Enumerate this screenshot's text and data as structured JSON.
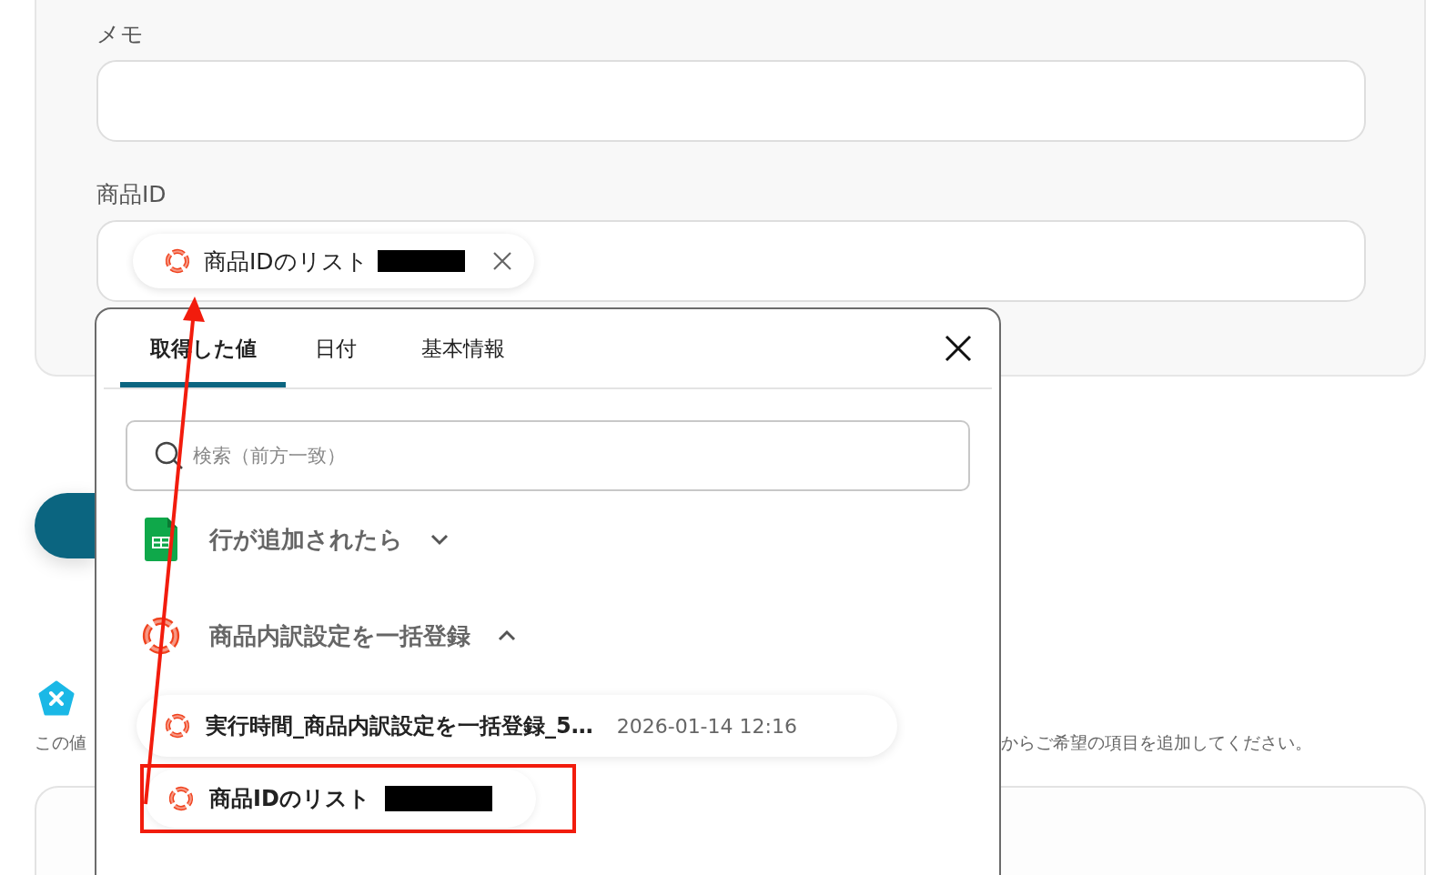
{
  "memo_field": {
    "label": "メモ"
  },
  "product_id_field": {
    "label": "商品ID",
    "chip": {
      "label": "商品IDのリスト",
      "redacted": true
    }
  },
  "popup": {
    "tabs": [
      {
        "label": "取得した値",
        "selected": true
      },
      {
        "label": "日付",
        "selected": false
      },
      {
        "label": "基本情報",
        "selected": false
      }
    ],
    "search": {
      "placeholder": "検索（前方一致）"
    },
    "groups": [
      {
        "title": "行が追加されたら",
        "kind": "sheet",
        "expanded": false
      },
      {
        "title": "商品内訳設定を一括登録",
        "kind": "ring",
        "expanded": true,
        "items": [
          {
            "label": "実行時間_商品内訳設定を一括登録_5…",
            "value": "2026-01-14 12:16"
          },
          {
            "label": "商品IDのリスト",
            "redacted": true,
            "highlighted": true
          }
        ]
      }
    ]
  },
  "hint": [
    "この値",
    "からご希望の項目を追加してください。"
  ]
}
